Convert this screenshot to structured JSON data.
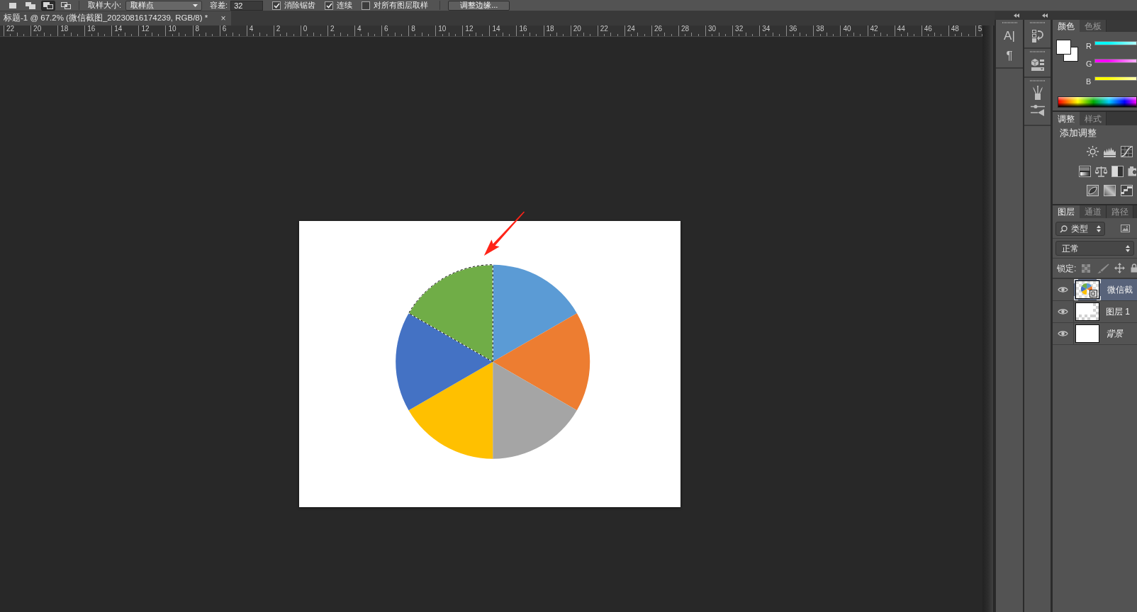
{
  "options_bar": {
    "selection_modes": [
      {
        "selected": false
      },
      {
        "selected": false
      },
      {
        "selected": true
      },
      {
        "selected": false
      }
    ],
    "sample_size_label": "取样大小:",
    "sample_size_value": "取样点",
    "tolerance_label": "容差:",
    "tolerance_value": "32",
    "checkboxes": [
      {
        "label": "消除锯齿",
        "checked": true
      },
      {
        "label": "连续",
        "checked": true
      },
      {
        "label": "对所有图层取样",
        "checked": false
      }
    ],
    "refine_edge_button": "调整边缘..."
  },
  "document_tab": {
    "title": "标题-1 @ 67.2% (微信截图_20230816174239, RGB/8) *",
    "close": "×"
  },
  "ruler": {
    "labels": [
      "22",
      "20",
      "18",
      "16",
      "14",
      "12",
      "10",
      "8",
      "6",
      "4",
      "2",
      "0",
      "2",
      "4",
      "6",
      "8",
      "10",
      "12",
      "14",
      "16",
      "18",
      "20",
      "22",
      "24",
      "26",
      "28",
      "30",
      "32",
      "34",
      "36",
      "38",
      "40",
      "42",
      "44",
      "46",
      "48",
      "5"
    ]
  },
  "document": {
    "slices": [
      {
        "color": "#5b9bd5",
        "selected": false
      },
      {
        "color": "#ed7d31",
        "selected": false
      },
      {
        "color": "#a5a5a5",
        "selected": false
      },
      {
        "color": "#ffc000",
        "selected": false
      },
      {
        "color": "#4472c4",
        "selected": false
      },
      {
        "color": "#70ad47",
        "selected": true
      }
    ]
  },
  "dock": {
    "text_buttons": [
      "A|",
      "¶"
    ]
  },
  "color_panel": {
    "tabs": [
      {
        "label": "颜色",
        "selected": true
      },
      {
        "label": "色板",
        "selected": false
      }
    ],
    "channels": [
      {
        "label": "R",
        "color": "#00ffff"
      },
      {
        "label": "G",
        "color": "#ff00ff"
      },
      {
        "label": "B",
        "color": "#ffff00"
      }
    ]
  },
  "adjustments_panel": {
    "tabs": [
      {
        "label": "调整",
        "selected": true
      },
      {
        "label": "样式",
        "selected": false
      }
    ],
    "heading": "添加调整"
  },
  "layers_panel": {
    "tabs": [
      {
        "label": "图层",
        "selected": true
      },
      {
        "label": "通道",
        "selected": false
      },
      {
        "label": "路径",
        "selected": false
      }
    ],
    "filter_value": "类型",
    "blend_mode": "正常",
    "lock_label": "锁定:",
    "layers": [
      {
        "name": "微信截",
        "kind": "smart-object",
        "selected": true,
        "visible": true
      },
      {
        "name": "图层 1",
        "kind": "pixel",
        "selected": false,
        "visible": true
      },
      {
        "name": "背景",
        "kind": "background",
        "selected": false,
        "visible": true
      }
    ]
  }
}
